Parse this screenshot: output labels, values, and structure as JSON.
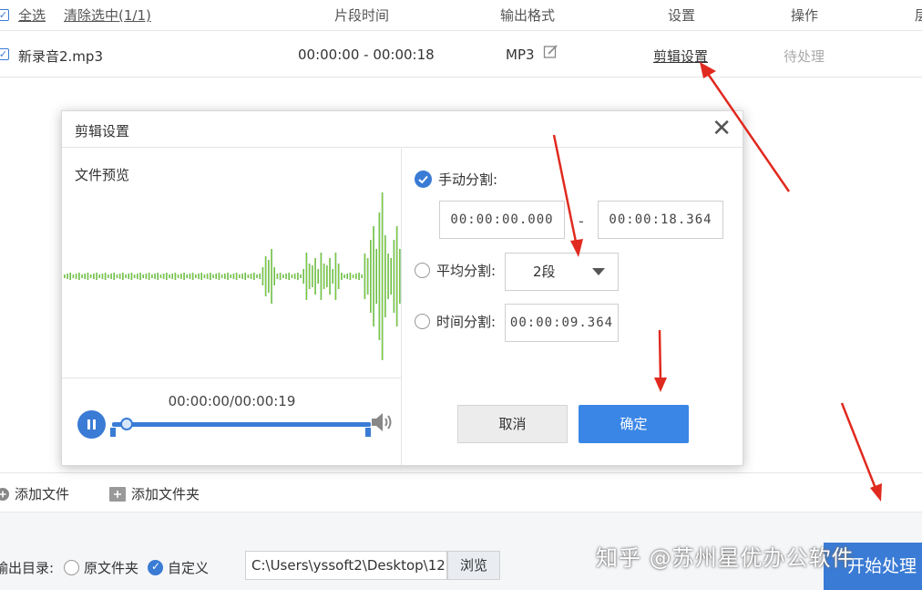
{
  "file_list": {
    "header": {
      "select_all": "全选",
      "clear_selection": "清除选中(1/1)",
      "segment_time": "片段时间",
      "output_format": "输出格式",
      "settings": "设置",
      "actions": "操作",
      "cut_off_column": "层"
    },
    "rows": [
      {
        "name": "新录音2.mp3",
        "segment": "00:00:00 - 00:00:18",
        "format": "MP3",
        "settings_link": "剪辑设置",
        "status": "待处理"
      }
    ]
  },
  "dialog": {
    "title": "剪辑设置",
    "preview_label": "文件预览",
    "time_readout": "00:00:00/00:00:19",
    "playback_progress": 0.0,
    "options": {
      "manual": {
        "label": "手动分割:",
        "checked": true,
        "start": "00:00:00.000",
        "dash": "-",
        "end": "00:00:18.364"
      },
      "average": {
        "label": "平均分割:",
        "checked": false,
        "selected": "2段"
      },
      "time": {
        "label": "时间分割:",
        "checked": false,
        "value": "00:00:09.364"
      }
    },
    "cancel_label": "取消",
    "ok_label": "确定"
  },
  "bottom": {
    "add_file": "添加文件",
    "add_folder": "添加文件夹",
    "output_dir_label": "输出目录:",
    "radio_original": "原文件夹",
    "radio_custom": "自定义",
    "custom_selected": true,
    "path": "C:\\Users\\yssoft2\\Desktop\\12",
    "browse": "浏览",
    "start": "开始处理",
    "watermark": "知乎 @苏州星优办公软件"
  },
  "colors": {
    "accent": "#3a7bd5",
    "button_ok": "#3a86e6",
    "arrow": "#e02a1f"
  }
}
